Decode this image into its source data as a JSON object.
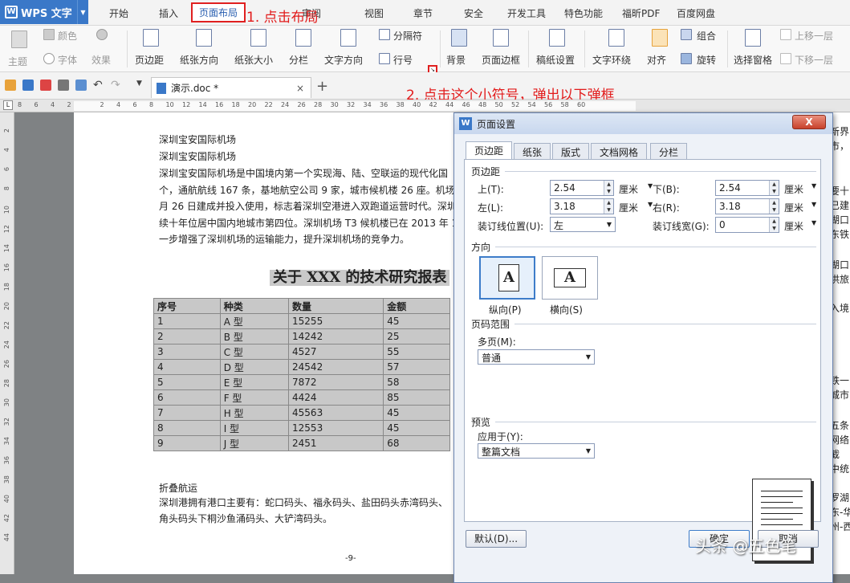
{
  "app": {
    "brand": "WPS 文字"
  },
  "menu_tabs": [
    "开始",
    "插入",
    "页面布局",
    "引用",
    "审阅",
    "视图",
    "章节",
    "安全",
    "开发工具",
    "特色功能",
    "福昕PDF",
    "百度网盘"
  ],
  "annotations": {
    "step1": "1. 点击布局",
    "step2": "2. 点击这个小符号，弹出以下弹框"
  },
  "ribbon": {
    "theme": "主题",
    "colors": "颜色",
    "fonts": "字体",
    "effects": "效果",
    "margins": "页边距",
    "orientation": "纸张方向",
    "size": "纸张大小",
    "columns": "分栏",
    "text_direction": "文字方向",
    "breaks": "分隔符",
    "line_numbers": "行号",
    "background": "背景",
    "page_border": "页面边框",
    "paper_settings": "稿纸设置",
    "wrap": "文字环绕",
    "align": "对齐",
    "rotate": "旋转",
    "group": "组合",
    "selection_pane": "选择窗格",
    "bring_forward": "上移一层",
    "send_backward": "下移一层"
  },
  "doc_tab": {
    "name": "演示.doc *"
  },
  "ruler": {
    "h": [
      "8",
      "6",
      "4",
      "2",
      "",
      "2",
      "4",
      "6",
      "8",
      "10",
      "12",
      "14",
      "16",
      "18",
      "20",
      "22",
      "24",
      "26",
      "28",
      "30",
      "32",
      "34",
      "36",
      "38",
      "40",
      "42",
      "44",
      "46",
      "48",
      "50",
      "52",
      "54",
      "56",
      "58",
      "60"
    ],
    "v": [
      "2",
      "4",
      "6",
      "8",
      "10",
      "12",
      "14",
      "16",
      "18",
      "20",
      "22",
      "24",
      "26",
      "28",
      "30",
      "32",
      "34",
      "36",
      "38",
      "40",
      "42",
      "44"
    ]
  },
  "document": {
    "line_a": "深圳宝安国际机场",
    "line_b": "深圳宝安国际机场",
    "para1": [
      "深圳宝安国际机场是中国境内第一个实现海、陆、空联运的现代化国",
      "个，通航航线 167 条，基地航空公司 9 家，城市候机楼 26 座。机场",
      "月 26 日建成并投入使用，标志着深圳空港进入双跑道运营时代。深圳",
      "续十年位居中国内地城市第四位。深圳机场 T3 候机楼已在 2013 年 1",
      "一步增强了深圳机场的运输能力，提升深圳机场的竞争力。"
    ],
    "report_title": "关于 XXX 的技术研究报表",
    "table": {
      "headers": [
        "序号",
        "种类",
        "数量",
        "金额"
      ],
      "rows": [
        [
          "1",
          "A 型",
          "15255",
          "45"
        ],
        [
          "2",
          "B 型",
          "14242",
          "25"
        ],
        [
          "3",
          "C 型",
          "4527",
          "55"
        ],
        [
          "4",
          "D 型",
          "24542",
          "57"
        ],
        [
          "5",
          "E 型",
          "7872",
          "58"
        ],
        [
          "6",
          "F 型",
          "4424",
          "85"
        ],
        [
          "7",
          "H 型",
          "45563",
          "45"
        ],
        [
          "8",
          "I 型",
          "12553",
          "45"
        ],
        [
          "9",
          "J 型",
          "2451",
          "68"
        ]
      ]
    },
    "section": "折叠航运",
    "para2": [
      "深圳港拥有港口主要有：蛇口码头、福永码头、盐田码头赤湾码头、",
      "角头码头下桐沙鱼涌码头、大铲湾码头。"
    ],
    "page_no": "-9-",
    "right_snips": [
      "新界",
      "市，",
      "要十",
      "已建",
      "湖口",
      "东铁",
      "湖口",
      "供旅",
      "入境",
      "铁一",
      "城市",
      "五条",
      "网络",
      "截",
      "中统",
      "罗湖",
      "东-华",
      "州-西"
    ]
  },
  "dialog": {
    "title": "页面设置",
    "tabs": [
      "页边距",
      "纸张",
      "版式",
      "文档网格",
      "分栏"
    ],
    "margins_title": "页边距",
    "top_label": "上(T):",
    "top_value": "2.54",
    "bottom_label": "下(B):",
    "bottom_value": "2.54",
    "left_label": "左(L):",
    "left_value": "3.18",
    "right_label": "右(R):",
    "right_value": "3.18",
    "gutter_pos_label": "装订线位置(U):",
    "gutter_pos_value": "左",
    "gutter_label": "装订线宽(G):",
    "gutter_value": "0",
    "unit": "厘米",
    "orientation_title": "方向",
    "portrait": "纵向(P)",
    "landscape": "横向(S)",
    "pages_title": "页码范围",
    "multi_label": "多页(M):",
    "multi_value": "普通",
    "preview_title": "预览",
    "apply_label": "应用于(Y):",
    "apply_value": "整篇文档",
    "default_btn": "默认(D)...",
    "ok_btn": "确定",
    "cancel_btn": "取消",
    "close": "X"
  },
  "watermark": "头条 @五色笔"
}
